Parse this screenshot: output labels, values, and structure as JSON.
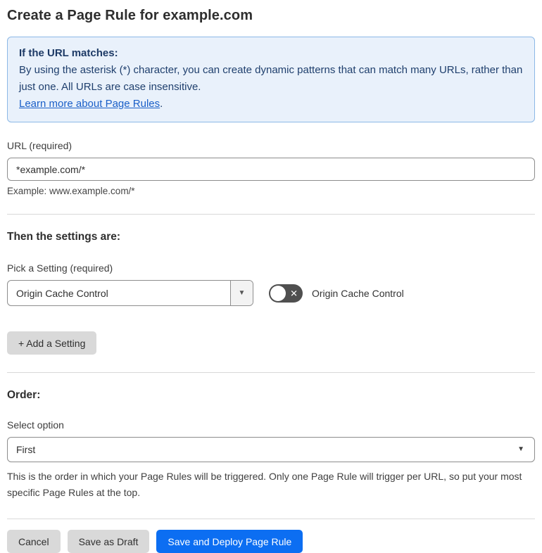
{
  "page": {
    "title": "Create a Page Rule for example.com"
  },
  "info_box": {
    "heading": "If the URL matches:",
    "body": "By using the asterisk (*) character, you can create dynamic patterns that can match many URLs, rather than just one. All URLs are case insensitive.",
    "link_label": "Learn more about Page Rules",
    "link_suffix": "."
  },
  "url_field": {
    "label": "URL (required)",
    "value": "*example.com/*",
    "helper": "Example: www.example.com/*"
  },
  "settings_section": {
    "heading": "Then the settings are:",
    "picker_label": "Pick a Setting (required)",
    "picker_value": "Origin Cache Control",
    "toggle_label": "Origin Cache Control",
    "toggle_state": "off",
    "add_setting_label": "+ Add a Setting"
  },
  "order_section": {
    "heading": "Order:",
    "select_label": "Select option",
    "select_value": "First",
    "help_text": "This is the order in which your Page Rules will be triggered. Only one Page Rule will trigger per URL, so put your most specific Page Rules at the top."
  },
  "footer": {
    "cancel_label": "Cancel",
    "save_draft_label": "Save as Draft",
    "save_deploy_label": "Save and Deploy Page Rule"
  },
  "icons": {
    "picker_arrow": "▼",
    "order_arrow": "▼",
    "toggle_off_x": "✕"
  },
  "colors": {
    "info_background": "#e9f1fb",
    "info_border": "#8cb8e6",
    "info_text": "#20406e",
    "link_blue": "#1a5fc8",
    "primary_blue": "#0c6ef2",
    "button_gray": "#d9d9d9",
    "toggle_off_gray": "#4f4f4f",
    "input_border": "#8d8d8d",
    "divider": "#d9d9d9"
  }
}
